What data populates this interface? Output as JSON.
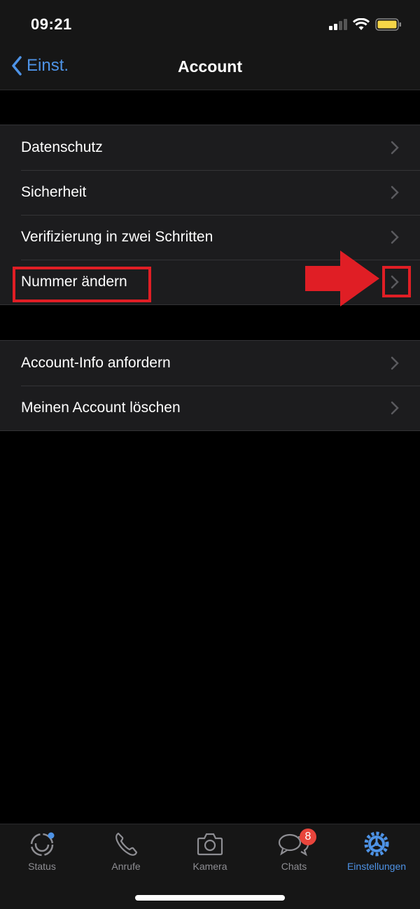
{
  "status_bar": {
    "time": "09:21",
    "battery_color": "#f5d547"
  },
  "nav": {
    "back_label": "Einst.",
    "title": "Account"
  },
  "groups": [
    {
      "items": [
        {
          "label": "Datenschutz"
        },
        {
          "label": "Sicherheit"
        },
        {
          "label": "Verifizierung in zwei Schritten"
        },
        {
          "label": "Nummer ändern",
          "highlighted": true
        }
      ]
    },
    {
      "items": [
        {
          "label": "Account-Info anfordern"
        },
        {
          "label": "Meinen Account löschen"
        }
      ]
    }
  ],
  "annotation": {
    "color": "#e01e25",
    "target": "Nummer ändern"
  },
  "tabbar": {
    "tabs": [
      {
        "label": "Status",
        "icon": "status-icon"
      },
      {
        "label": "Anrufe",
        "icon": "phone-icon"
      },
      {
        "label": "Kamera",
        "icon": "camera-icon"
      },
      {
        "label": "Chats",
        "icon": "chats-icon",
        "badge": "8"
      },
      {
        "label": "Einstellungen",
        "icon": "settings-icon",
        "active": true
      }
    ]
  },
  "colors": {
    "accent": "#4e93e6",
    "badge": "#e8453c"
  }
}
